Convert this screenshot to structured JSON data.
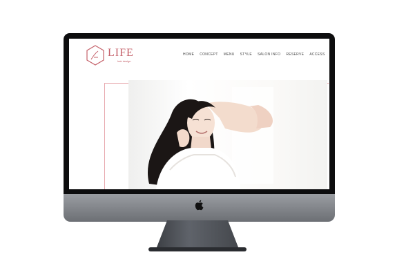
{
  "site": {
    "logo_text": "LIFE",
    "logo_sub": "hair design",
    "brand_color": "#c5616a"
  },
  "nav": {
    "items": [
      "HOME",
      "CONCEPT",
      "MENU",
      "STYLE",
      "SALON INFO",
      "RESERVE",
      "ACCESS"
    ]
  },
  "hero": {
    "image": "woman-portrait-photo"
  },
  "device": {
    "type": "imac",
    "logo_icon": "apple-icon"
  }
}
